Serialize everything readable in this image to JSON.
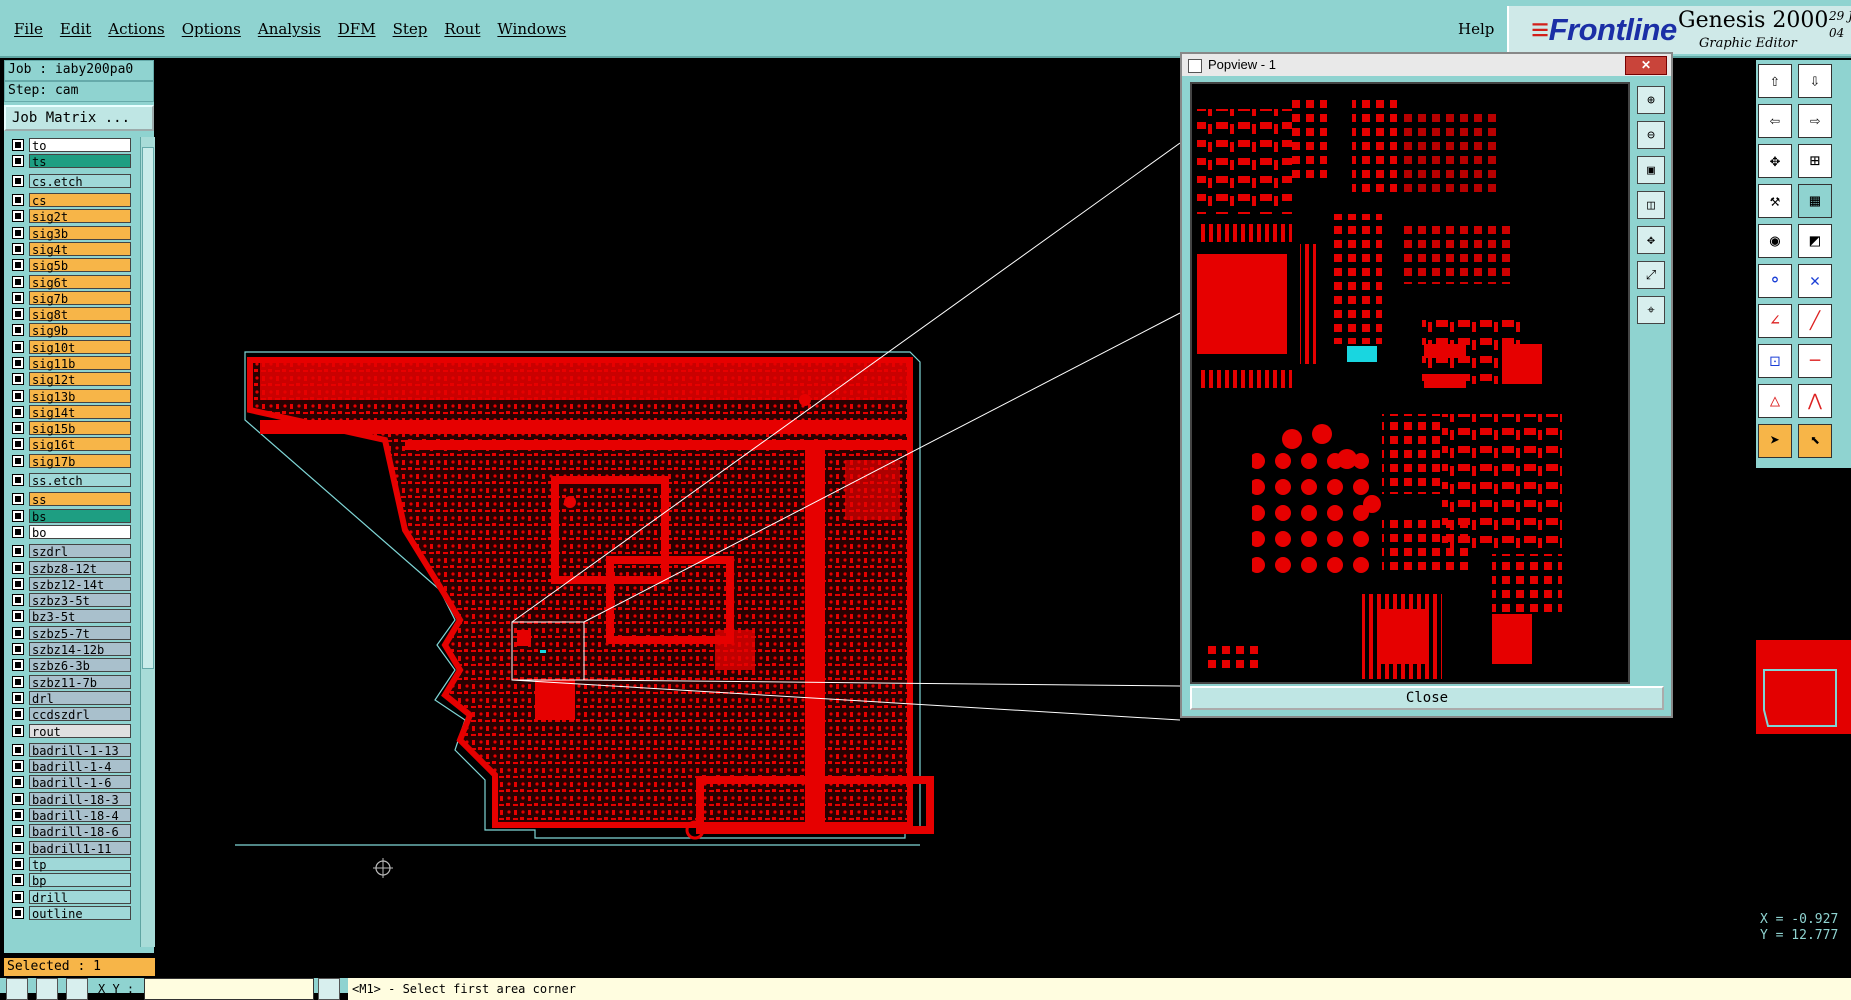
{
  "menu": {
    "items": [
      "File",
      "Edit",
      "Actions",
      "Options",
      "Analysis",
      "DFM",
      "Step",
      "Rout",
      "Windows"
    ],
    "help": "Help"
  },
  "brand": {
    "logo": "Frontline",
    "product": "Genesis 2000",
    "subtitle": "Graphic Editor",
    "date_fragment_1": "29 J",
    "date_fragment_2": "04"
  },
  "job": {
    "job_label": "Job : iaby200pa0",
    "step_label": "Step: cam",
    "matrix_button": "Job Matrix ..."
  },
  "layers": [
    {
      "name": "to",
      "color": "w"
    },
    {
      "name": "ts",
      "color": "g"
    },
    {
      "sep": true
    },
    {
      "name": "cs.etch",
      "color": "t"
    },
    {
      "sep": true
    },
    {
      "name": "cs",
      "color": "o"
    },
    {
      "name": "sig2t",
      "color": "o"
    },
    {
      "name": "sig3b",
      "color": "o"
    },
    {
      "name": "sig4t",
      "color": "o"
    },
    {
      "name": "sig5b",
      "color": "o"
    },
    {
      "name": "sig6t",
      "color": "o"
    },
    {
      "name": "sig7b",
      "color": "o"
    },
    {
      "name": "sig8t",
      "color": "o"
    },
    {
      "name": "sig9b",
      "color": "o"
    },
    {
      "name": "sig10t",
      "color": "o"
    },
    {
      "name": "sig11b",
      "color": "o"
    },
    {
      "name": "sig12t",
      "color": "o"
    },
    {
      "name": "sig13b",
      "color": "o"
    },
    {
      "name": "sig14t",
      "color": "o"
    },
    {
      "name": "sig15b",
      "color": "o"
    },
    {
      "name": "sig16t",
      "color": "o"
    },
    {
      "name": "sig17b",
      "color": "o"
    },
    {
      "sep": true
    },
    {
      "name": "ss.etch",
      "color": "t"
    },
    {
      "sep": true
    },
    {
      "name": "ss",
      "color": "o"
    },
    {
      "name": "bs",
      "color": "g"
    },
    {
      "name": "bo",
      "color": "w"
    },
    {
      "sep": true
    },
    {
      "name": "szdrl",
      "color": "b"
    },
    {
      "name": "szbz8-12t",
      "color": "b"
    },
    {
      "name": "szbz12-14t",
      "color": "b"
    },
    {
      "name": "szbz3-5t",
      "color": "b"
    },
    {
      "name": "bz3-5t",
      "color": "b"
    },
    {
      "name": "szbz5-7t",
      "color": "b"
    },
    {
      "name": "szbz14-12b",
      "color": "b"
    },
    {
      "name": "szbz6-3b",
      "color": "b"
    },
    {
      "name": "szbz11-7b",
      "color": "b"
    },
    {
      "name": "drl",
      "color": "b"
    },
    {
      "name": "ccdszdrl",
      "color": "b"
    },
    {
      "name": "rout",
      "color": "lg"
    },
    {
      "sep": true
    },
    {
      "name": "badrill-1-13",
      "color": "b"
    },
    {
      "name": "badrill-1-4",
      "color": "b"
    },
    {
      "name": "badrill-1-6",
      "color": "b"
    },
    {
      "name": "badrill-18-3",
      "color": "b"
    },
    {
      "name": "badrill-18-4",
      "color": "b"
    },
    {
      "name": "badrill-18-6",
      "color": "b"
    },
    {
      "name": "badrill1-11",
      "color": "b"
    },
    {
      "name": "tp",
      "color": "t"
    },
    {
      "name": "bp",
      "color": "t"
    },
    {
      "name": "drill",
      "color": "t"
    },
    {
      "name": "outline",
      "color": "t"
    }
  ],
  "selected": "Selected : 1",
  "bottom": {
    "xy_label": "X Y :",
    "xy_value": "",
    "status": "<M1> - Select first area corner"
  },
  "popview": {
    "title": "Popview - 1",
    "close_label": "Close"
  },
  "coords": {
    "x": "X = -0.927",
    "y": "Y = 12.777"
  },
  "colors": {
    "panel": "#8fd3d0",
    "copper": "#e60000",
    "highlight": "#19d6e0",
    "outline": "#7fd6d6"
  }
}
